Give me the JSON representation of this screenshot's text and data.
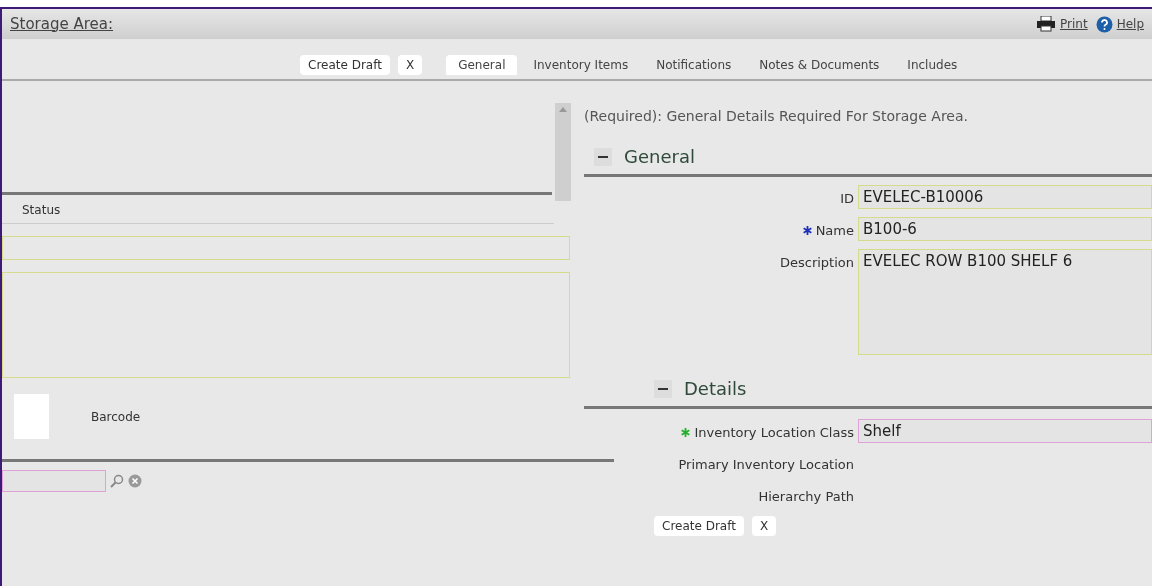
{
  "header": {
    "title": "Storage Area:",
    "links": [
      {
        "kind": "print",
        "label": "Print"
      },
      {
        "kind": "help",
        "label": "Help"
      }
    ]
  },
  "toolbar": {
    "buttons": [
      "Create Draft",
      "X"
    ],
    "tabs": [
      {
        "label": "General",
        "selected": true
      },
      {
        "label": "Inventory Items",
        "selected": false
      },
      {
        "label": "Notifications",
        "selected": false
      },
      {
        "label": "Notes & Documents",
        "selected": false
      },
      {
        "label": "Includes",
        "selected": false
      }
    ]
  },
  "left_panel": {
    "status_label": "Status",
    "barcode_label": "Barcode"
  },
  "form": {
    "notice": "(Required): General Details Required For Storage Area.",
    "sections": [
      {
        "title": "General",
        "expanded": true,
        "fields": [
          {
            "label": "ID",
            "value": "EVELEC-B10006",
            "required": false,
            "kind": "input"
          },
          {
            "label": "Name",
            "value": "B100-6",
            "required": true,
            "kind": "input"
          },
          {
            "label": "Description",
            "value": "EVELEC ROW B100 SHELF 6",
            "required": false,
            "kind": "textarea"
          }
        ]
      },
      {
        "title": "Details",
        "expanded": true,
        "fields": [
          {
            "label": "Inventory Location Class",
            "value": "Shelf",
            "required": true,
            "kind": "input"
          },
          {
            "label": "Primary Inventory Location",
            "required": false,
            "kind": "text"
          },
          {
            "label": "Hierarchy Path",
            "required": false,
            "kind": "text"
          }
        ]
      }
    ]
  },
  "footer": {
    "buttons": [
      "Create Draft",
      "X"
    ]
  }
}
